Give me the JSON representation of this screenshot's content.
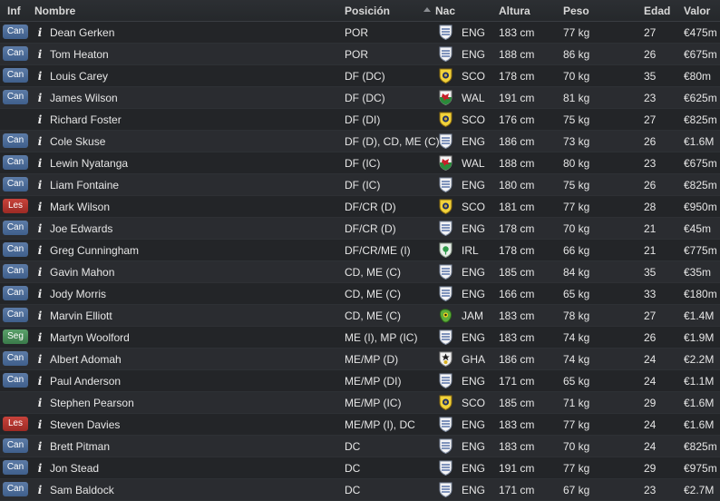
{
  "headers": {
    "inf": "Inf",
    "nombre": "Nombre",
    "posicion": "Posición",
    "nac": "Nac",
    "altura": "Altura",
    "peso": "Peso",
    "edad": "Edad",
    "valor": "Valor"
  },
  "colors": {
    "can": "#4b6c9a",
    "les": "#b3362f",
    "seg": "#4a8e5a"
  },
  "rows": [
    {
      "inf": "Can",
      "name": "Dean Gerken",
      "pos": "POR",
      "flag": "eng-shield-icon",
      "nat": "ENG",
      "alt": "183 cm",
      "peso": "77 kg",
      "edad": "27",
      "valor": "€475m"
    },
    {
      "inf": "Can",
      "name": "Tom Heaton",
      "pos": "POR",
      "flag": "eng-shield-icon",
      "nat": "ENG",
      "alt": "188 cm",
      "peso": "86 kg",
      "edad": "26",
      "valor": "€675m"
    },
    {
      "inf": "Can",
      "name": "Louis Carey",
      "pos": "DF (DC)",
      "flag": "sco-shield-icon",
      "nat": "SCO",
      "alt": "178 cm",
      "peso": "70 kg",
      "edad": "35",
      "valor": "€80m"
    },
    {
      "inf": "Can",
      "name": "James Wilson",
      "pos": "DF (DC)",
      "flag": "wal-shield-icon",
      "nat": "WAL",
      "alt": "191 cm",
      "peso": "81 kg",
      "edad": "23",
      "valor": "€625m"
    },
    {
      "inf": "",
      "name": "Richard Foster",
      "pos": "DF (DI)",
      "flag": "sco-shield-icon",
      "nat": "SCO",
      "alt": "176 cm",
      "peso": "75 kg",
      "edad": "27",
      "valor": "€825m"
    },
    {
      "inf": "Can",
      "name": "Cole Skuse",
      "pos": "DF (D), CD, ME (C)",
      "flag": "eng-shield-icon",
      "nat": "ENG",
      "alt": "186 cm",
      "peso": "73 kg",
      "edad": "26",
      "valor": "€1.6M"
    },
    {
      "inf": "Can",
      "name": "Lewin Nyatanga",
      "pos": "DF (IC)",
      "flag": "wal-shield-icon",
      "nat": "WAL",
      "alt": "188 cm",
      "peso": "80 kg",
      "edad": "23",
      "valor": "€675m"
    },
    {
      "inf": "Can",
      "name": "Liam Fontaine",
      "pos": "DF (IC)",
      "flag": "eng-shield-icon",
      "nat": "ENG",
      "alt": "180 cm",
      "peso": "75 kg",
      "edad": "26",
      "valor": "€825m"
    },
    {
      "inf": "Les",
      "name": "Mark Wilson",
      "pos": "DF/CR (D)",
      "flag": "sco-shield-icon",
      "nat": "SCO",
      "alt": "181 cm",
      "peso": "77 kg",
      "edad": "28",
      "valor": "€950m"
    },
    {
      "inf": "Can",
      "name": "Joe Edwards",
      "pos": "DF/CR (D)",
      "flag": "eng-shield-icon",
      "nat": "ENG",
      "alt": "178 cm",
      "peso": "70 kg",
      "edad": "21",
      "valor": "€45m"
    },
    {
      "inf": "Can",
      "name": "Greg Cunningham",
      "pos": "DF/CR/ME (I)",
      "flag": "irl-shield-icon",
      "nat": "IRL",
      "alt": "178 cm",
      "peso": "66 kg",
      "edad": "21",
      "valor": "€775m"
    },
    {
      "inf": "Can",
      "name": "Gavin Mahon",
      "pos": "CD, ME (C)",
      "flag": "eng-shield-icon",
      "nat": "ENG",
      "alt": "185 cm",
      "peso": "84 kg",
      "edad": "35",
      "valor": "€35m"
    },
    {
      "inf": "Can",
      "name": "Jody Morris",
      "pos": "CD, ME (C)",
      "flag": "eng-shield-icon",
      "nat": "ENG",
      "alt": "166 cm",
      "peso": "65 kg",
      "edad": "33",
      "valor": "€180m"
    },
    {
      "inf": "Can",
      "name": "Marvin Elliott",
      "pos": "CD, ME (C)",
      "flag": "jam-shield-icon",
      "nat": "JAM",
      "alt": "183 cm",
      "peso": "78 kg",
      "edad": "27",
      "valor": "€1.4M"
    },
    {
      "inf": "Seg",
      "name": "Martyn Woolford",
      "pos": "ME (I), MP (IC)",
      "flag": "eng-shield-icon",
      "nat": "ENG",
      "alt": "183 cm",
      "peso": "74 kg",
      "edad": "26",
      "valor": "€1.9M"
    },
    {
      "inf": "Can",
      "name": "Albert Adomah",
      "pos": "ME/MP (D)",
      "flag": "gha-shield-icon",
      "nat": "GHA",
      "alt": "186 cm",
      "peso": "74 kg",
      "edad": "24",
      "valor": "€2.2M"
    },
    {
      "inf": "Can",
      "name": "Paul Anderson",
      "pos": "ME/MP (DI)",
      "flag": "eng-shield-icon",
      "nat": "ENG",
      "alt": "171 cm",
      "peso": "65 kg",
      "edad": "24",
      "valor": "€1.1M"
    },
    {
      "inf": "",
      "name": "Stephen Pearson",
      "pos": "ME/MP (IC)",
      "flag": "sco-shield-icon",
      "nat": "SCO",
      "alt": "185 cm",
      "peso": "71 kg",
      "edad": "29",
      "valor": "€1.6M"
    },
    {
      "inf": "Les",
      "name": "Steven Davies",
      "pos": "ME/MP (I), DC",
      "flag": "eng-shield-icon",
      "nat": "ENG",
      "alt": "183 cm",
      "peso": "77 kg",
      "edad": "24",
      "valor": "€1.6M"
    },
    {
      "inf": "Can",
      "name": "Brett Pitman",
      "pos": "DC",
      "flag": "eng-shield-icon",
      "nat": "ENG",
      "alt": "183 cm",
      "peso": "70 kg",
      "edad": "24",
      "valor": "€825m"
    },
    {
      "inf": "Can",
      "name": "Jon Stead",
      "pos": "DC",
      "flag": "eng-shield-icon",
      "nat": "ENG",
      "alt": "191 cm",
      "peso": "77 kg",
      "edad": "29",
      "valor": "€975m"
    },
    {
      "inf": "Can",
      "name": "Sam Baldock",
      "pos": "DC",
      "flag": "eng-shield-icon",
      "nat": "ENG",
      "alt": "171 cm",
      "peso": "67 kg",
      "edad": "23",
      "valor": "€2.7M"
    }
  ]
}
